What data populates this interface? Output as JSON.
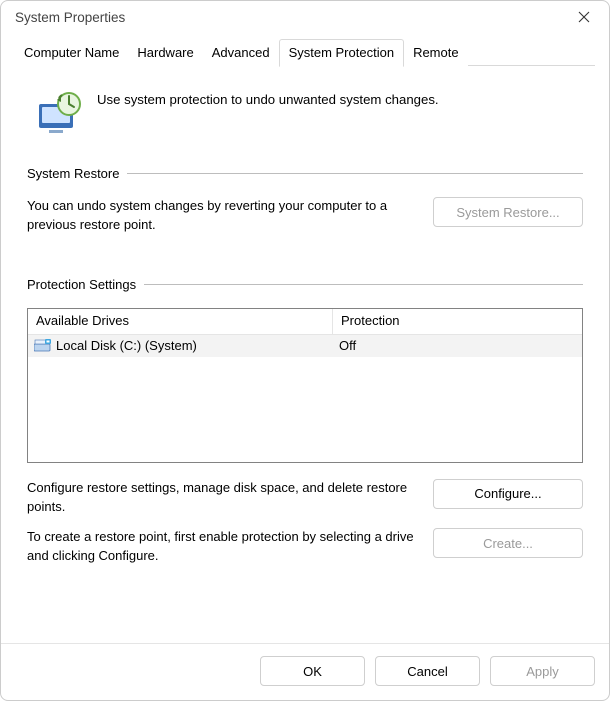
{
  "window": {
    "title": "System Properties"
  },
  "tabs": {
    "computer_name": "Computer Name",
    "hardware": "Hardware",
    "advanced": "Advanced",
    "system_protection": "System Protection",
    "remote": "Remote",
    "active": "system_protection"
  },
  "intro": {
    "text": "Use system protection to undo unwanted system changes."
  },
  "system_restore": {
    "heading": "System Restore",
    "desc": "You can undo system changes by reverting your computer to a previous restore point.",
    "button": "System Restore..."
  },
  "protection_settings": {
    "heading": "Protection Settings",
    "columns": {
      "drives": "Available Drives",
      "protection": "Protection"
    },
    "rows": [
      {
        "name": "Local Disk (C:) (System)",
        "protection": "Off"
      }
    ],
    "configure_desc": "Configure restore settings, manage disk space, and delete restore points.",
    "configure_button": "Configure...",
    "create_desc": "To create a restore point, first enable protection by selecting a drive and clicking Configure.",
    "create_button": "Create..."
  },
  "footer": {
    "ok": "OK",
    "cancel": "Cancel",
    "apply": "Apply"
  }
}
